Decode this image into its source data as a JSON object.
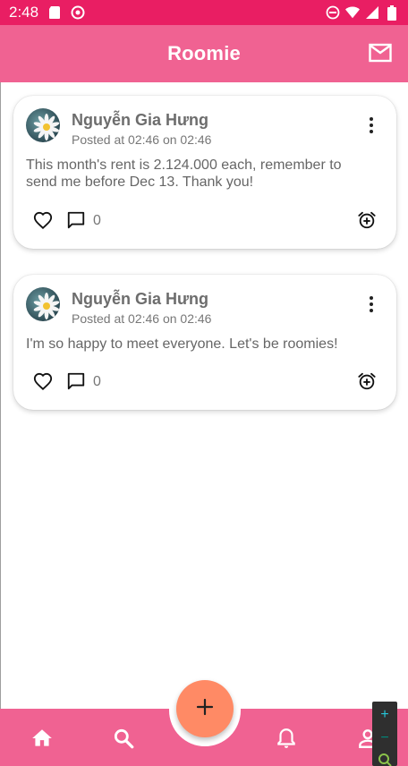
{
  "status_bar": {
    "time": "2:48",
    "icons": [
      "sd-card-icon",
      "data-saver-icon",
      "do-not-disturb-icon",
      "wifi-icon",
      "signal-icon",
      "battery-icon"
    ]
  },
  "app_bar": {
    "title": "Roomie",
    "actions": [
      "mail-icon"
    ]
  },
  "posts": [
    {
      "author": "Nguyễn Gia Hưng",
      "posted": "Posted at 02:46 on 02:46",
      "text": "This month's rent is 2.124.000 each, remember to send me before Dec 13. Thank you!",
      "comment_count": "0"
    },
    {
      "author": "Nguyễn Gia Hưng",
      "posted": "Posted at 02:46 on 02:46",
      "text": "I'm so happy to meet everyone. Let's be roomies!",
      "comment_count": "0"
    }
  ],
  "bottom_nav": {
    "items": [
      "home-icon",
      "search-icon",
      "bell-icon",
      "profile-icon"
    ],
    "fab": "add-icon"
  },
  "colors": {
    "status_bar": "#e91e63",
    "app_bar": "#f06292",
    "fab": "#ff8a65",
    "text_secondary": "#6d6d6d"
  }
}
